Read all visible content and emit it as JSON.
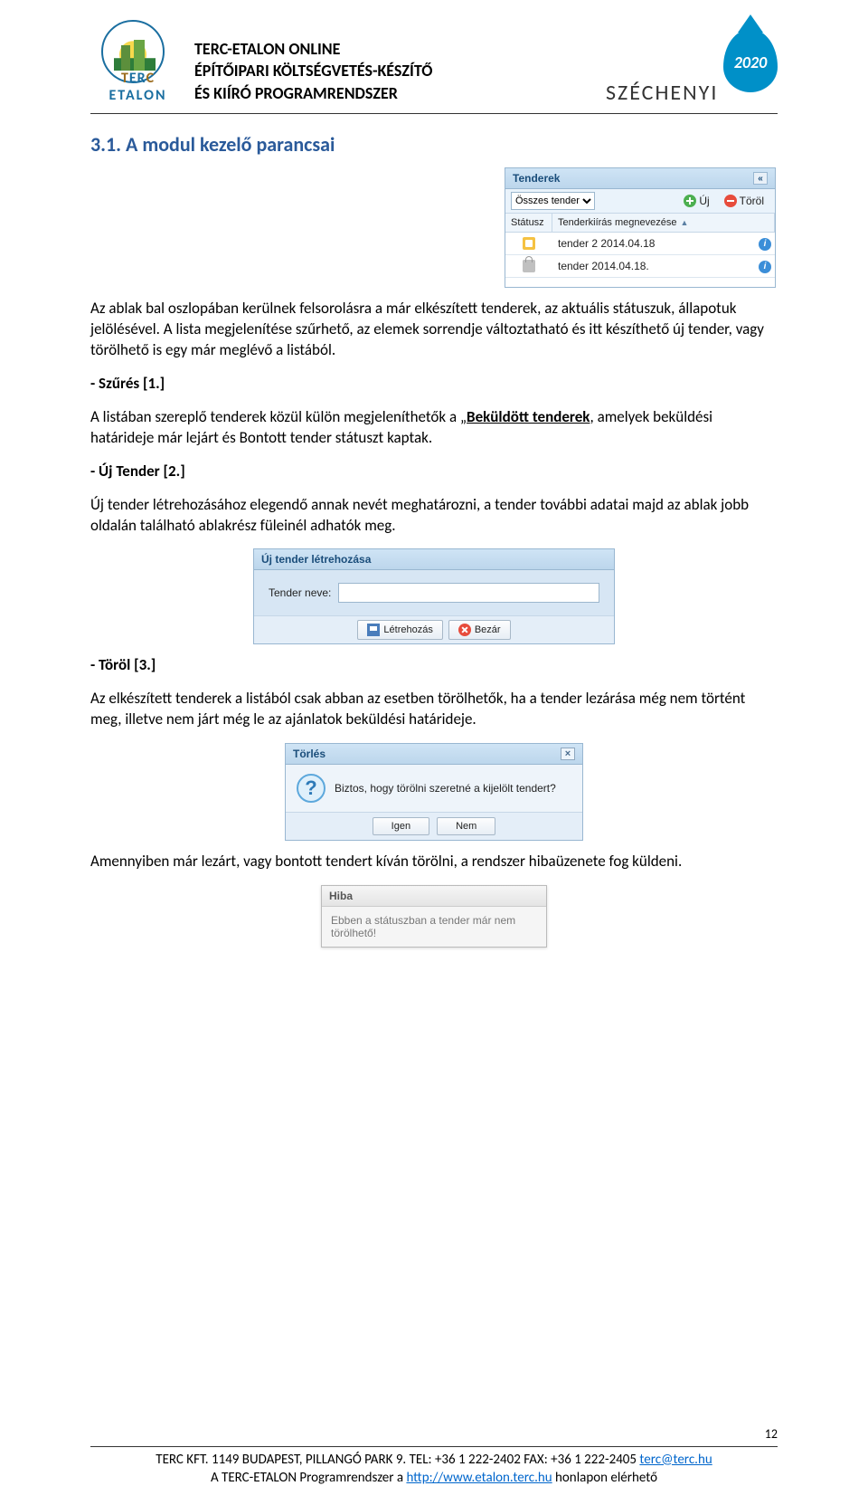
{
  "header": {
    "brand_prefix": "T",
    "brand_mid": "ER",
    "brand_suffix": "C",
    "brand_sub": "ETALON",
    "line1": "TERC-ETALON ONLINE",
    "line2": "ÉPÍTŐIPARI KÖLTSÉGVETÉS-KÉSZÍTŐ",
    "line3": "ÉS KIÍRÓ PROGRAMRENDSZER",
    "szechenyi_text": "SZÉCHENYI",
    "szechenyi_year": "2020"
  },
  "section_heading": "3.1. A modul kezelő parancsai",
  "tenderek_panel": {
    "title": "Tenderek",
    "collapse_glyph": "«",
    "filter_selected": "Összes tender",
    "btn_new": "Új",
    "btn_delete": "Töröl",
    "columns": {
      "status": "Státusz",
      "name": "Tenderkiírás megnevezése",
      "sort": "▲"
    },
    "rows": [
      {
        "status": "open",
        "name": "tender 2 2014.04.18"
      },
      {
        "status": "lock",
        "name": "tender 2014.04.18."
      }
    ],
    "info_glyph": "i"
  },
  "paragraphs": {
    "intro": "Az ablak bal oszlopában kerülnek felsorolásra a már elkészített tenderek, az aktuális státuszuk, állapotuk jelölésével. A lista megjelenítése szűrhető, az elemek sorrendje változtatható és itt készíthető új tender, vagy törölhető is egy már meglévő a listából.",
    "szures_label": "- Szűrés [1.]",
    "szures_text_a": "A listában szereplő tenderek közül külön megjeleníthetők a „",
    "szures_bold": "Beküldött tenderek",
    "szures_text_b": ", amelyek beküldési határideje már lejárt és Bontott tender státuszt kaptak.",
    "uj_label": "- Új Tender [2.]",
    "uj_text": "Új tender létrehozásához elegendő annak nevét meghatározni, a tender további adatai majd az ablak jobb oldalán található ablakrész füleinél adhatók meg.",
    "torol_label": "- Töröl [3.]",
    "torol_text": "Az elkészített tenderek a listából csak abban az esetben törölhetők, ha a tender lezárása még nem történt meg, illetve nem járt még le az ajánlatok beküldési határideje.",
    "after_delete": "Amennyiben már lezárt, vagy bontott tendert kíván törölni, a rendszer hibaüzenete fog küldeni."
  },
  "new_tender_dialog": {
    "title": "Új tender létrehozása",
    "label": "Tender neve:",
    "btn_create": "Létrehozás",
    "btn_close": "Bezár"
  },
  "delete_dialog": {
    "title": "Törlés",
    "close_glyph": "×",
    "question_glyph": "?",
    "message": "Biztos, hogy törölni szeretné a kijelölt tendert?",
    "btn_yes": "Igen",
    "btn_no": "Nem"
  },
  "error_box": {
    "title": "Hiba",
    "message": "Ebben a státuszban a tender már nem törölhető!"
  },
  "page_number": "12",
  "footer": {
    "line1_a": "TERC KFT. 1149 BUDAPEST, PILLANGÓ PARK 9. TEL: +36 1 222-2402 FAX: +36 1 222-2405 ",
    "email": "terc@terc.hu",
    "line2_a": "A TERC-ETALON Programrendszer a ",
    "url": "http://www.etalon.terc.hu",
    "line2_b": " honlapon elérhető"
  }
}
